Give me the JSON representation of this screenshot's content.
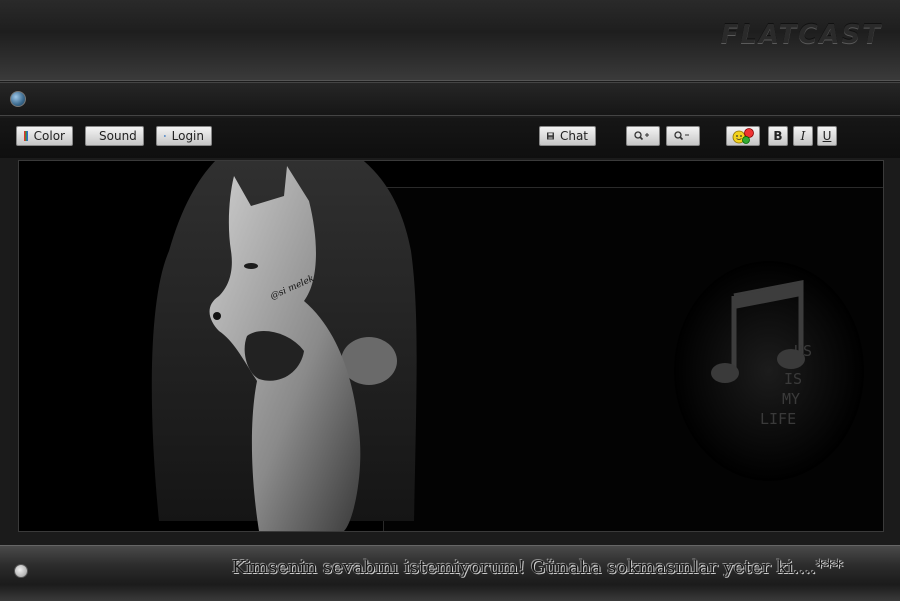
{
  "header": {
    "brand": "FLATCAST"
  },
  "toolbar": {
    "color_label": "Color",
    "sound_label": "Sound",
    "login_label": "Login",
    "chat_label": "Chat",
    "bold_label": "B",
    "italic_label": "I",
    "underline_label": "U"
  },
  "icons": {
    "globe": "globe-icon",
    "color": "color-icon",
    "sound": "speaker-icon",
    "login": "login-arrow-icon",
    "chat": "floppy-disk-icon",
    "zoom_in": "zoom-in-icon",
    "zoom_out": "zoom-out-icon",
    "emoticons": "emoticon-icon",
    "clock": "clock-icon"
  },
  "stage": {
    "watermark": "@si melek",
    "music_text": [
      "US",
      "IS",
      "MY",
      "LIFE"
    ]
  },
  "footer": {
    "marquee": "Kimsenin sevabını istemiyorum! Günaha sokmasınlar yeter ki....***"
  },
  "colors": {
    "background": "#1b1b1b",
    "stage": "#000000",
    "button": "#d9d9d9"
  }
}
